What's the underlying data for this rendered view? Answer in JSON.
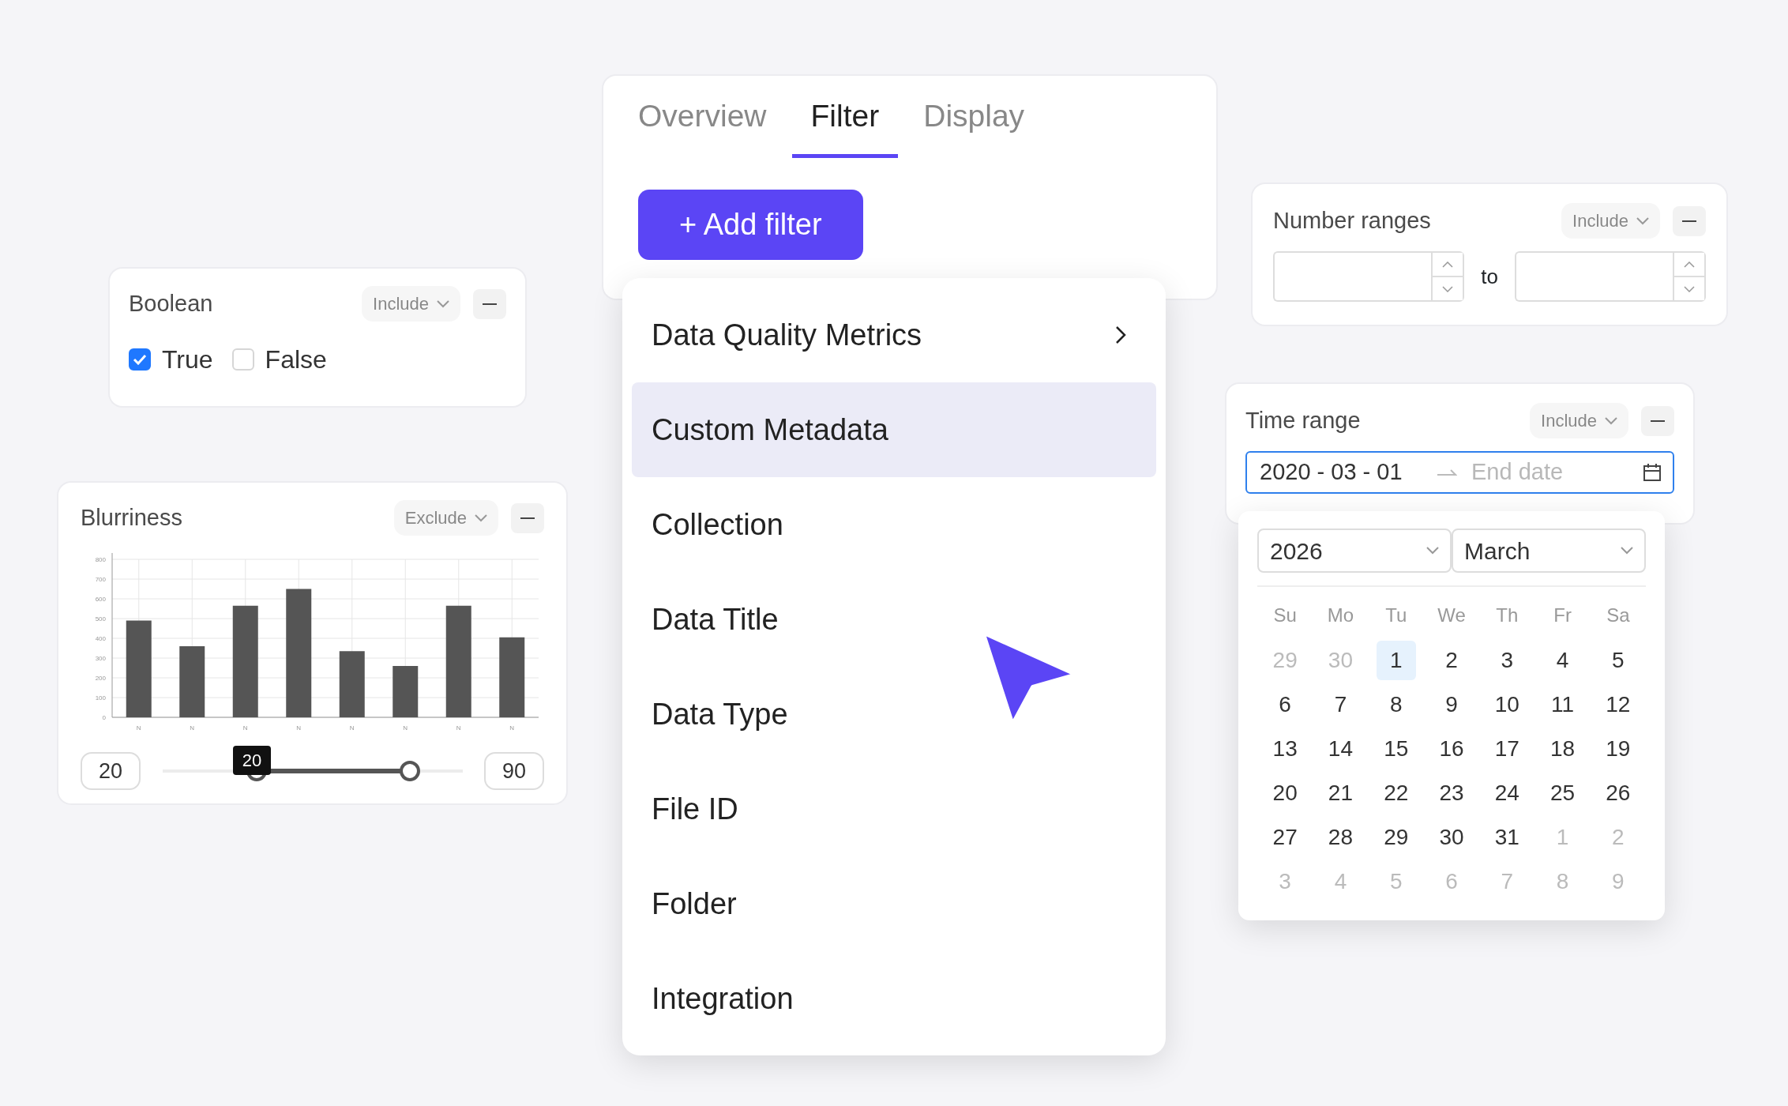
{
  "tabs_card": {
    "tabs": [
      {
        "label": "Overview",
        "selected": false
      },
      {
        "label": "Filter",
        "selected": true
      },
      {
        "label": "Display",
        "selected": false
      }
    ],
    "add_button": "+ Add filter"
  },
  "filter_menu": {
    "items": [
      {
        "label": "Data Quality Metrics",
        "selected": false,
        "has_submenu": true
      },
      {
        "label": "Custom Metadata",
        "selected": true,
        "has_submenu": false
      },
      {
        "label": "Collection",
        "selected": false,
        "has_submenu": false
      },
      {
        "label": "Data Title",
        "selected": false,
        "has_submenu": false
      },
      {
        "label": "Data Type",
        "selected": false,
        "has_submenu": false
      },
      {
        "label": "File ID",
        "selected": false,
        "has_submenu": false
      },
      {
        "label": "Folder",
        "selected": false,
        "has_submenu": false
      },
      {
        "label": "Integration",
        "selected": false,
        "has_submenu": false
      }
    ]
  },
  "boolean_card": {
    "title": "Boolean",
    "mode": "Include",
    "options": [
      {
        "label": "True",
        "checked": true
      },
      {
        "label": "False",
        "checked": false
      }
    ]
  },
  "blurriness_card": {
    "title": "Blurriness",
    "mode": "Exclude",
    "chart_data": {
      "type": "bar",
      "categories": [
        "N",
        "N",
        "N",
        "N",
        "N",
        "N",
        "N",
        "N"
      ],
      "grid": true,
      "series": [
        {
          "color": "#555555",
          "values": [
            490,
            360,
            565,
            650,
            335,
            260,
            565,
            405
          ]
        }
      ],
      "ylim": [
        0,
        800
      ],
      "yticks": [
        0,
        100,
        200,
        300,
        400,
        500,
        600,
        700,
        800
      ]
    },
    "min_value": "20",
    "max_value": "90",
    "tooltip": "20",
    "thumbs": [
      {
        "level": 0.3
      },
      {
        "level": 0.85
      }
    ]
  },
  "number_ranges_card": {
    "title": "Number ranges",
    "mode": "Include",
    "separator": "to"
  },
  "time_range_card": {
    "title": "Time range",
    "mode": "Include",
    "start_value": "2020 - 03 - 01",
    "end_placeholder": "End date",
    "focused": true
  },
  "calendar": {
    "year": "2026",
    "month": "March",
    "weekdays": [
      "Su",
      "Mo",
      "Tu",
      "We",
      "Th",
      "Fr",
      "Sa"
    ],
    "weeks": [
      [
        {
          "label": "29",
          "outside": true,
          "selected": false
        },
        {
          "label": "30",
          "outside": true,
          "selected": false
        },
        {
          "label": "1",
          "outside": false,
          "selected": true
        },
        {
          "label": "2",
          "outside": false,
          "selected": false
        },
        {
          "label": "3",
          "outside": false,
          "selected": false
        },
        {
          "label": "4",
          "outside": false,
          "selected": false
        },
        {
          "label": "5",
          "outside": false,
          "selected": false
        }
      ],
      [
        {
          "label": "6",
          "outside": false,
          "selected": false
        },
        {
          "label": "7",
          "outside": false,
          "selected": false
        },
        {
          "label": "8",
          "outside": false,
          "selected": false
        },
        {
          "label": "9",
          "outside": false,
          "selected": false
        },
        {
          "label": "10",
          "outside": false,
          "selected": false
        },
        {
          "label": "11",
          "outside": false,
          "selected": false
        },
        {
          "label": "12",
          "outside": false,
          "selected": false
        }
      ],
      [
        {
          "label": "13",
          "outside": false,
          "selected": false
        },
        {
          "label": "14",
          "outside": false,
          "selected": false
        },
        {
          "label": "15",
          "outside": false,
          "selected": false
        },
        {
          "label": "16",
          "outside": false,
          "selected": false
        },
        {
          "label": "17",
          "outside": false,
          "selected": false
        },
        {
          "label": "18",
          "outside": false,
          "selected": false
        },
        {
          "label": "19",
          "outside": false,
          "selected": false
        }
      ],
      [
        {
          "label": "20",
          "outside": false,
          "selected": false
        },
        {
          "label": "21",
          "outside": false,
          "selected": false
        },
        {
          "label": "22",
          "outside": false,
          "selected": false
        },
        {
          "label": "23",
          "outside": false,
          "selected": false
        },
        {
          "label": "24",
          "outside": false,
          "selected": false
        },
        {
          "label": "25",
          "outside": false,
          "selected": false
        },
        {
          "label": "26",
          "outside": false,
          "selected": false
        }
      ],
      [
        {
          "label": "27",
          "outside": false,
          "selected": false
        },
        {
          "label": "28",
          "outside": false,
          "selected": false
        },
        {
          "label": "29",
          "outside": false,
          "selected": false
        },
        {
          "label": "30",
          "outside": false,
          "selected": false
        },
        {
          "label": "31",
          "outside": false,
          "selected": false
        },
        {
          "label": "1",
          "outside": true,
          "selected": false
        },
        {
          "label": "2",
          "outside": true,
          "selected": false
        }
      ],
      [
        {
          "label": "3",
          "outside": true,
          "selected": false
        },
        {
          "label": "4",
          "outside": true,
          "selected": false
        },
        {
          "label": "5",
          "outside": true,
          "selected": false
        },
        {
          "label": "6",
          "outside": true,
          "selected": false
        },
        {
          "label": "7",
          "outside": true,
          "selected": false
        },
        {
          "label": "8",
          "outside": true,
          "selected": false
        },
        {
          "label": "9",
          "outside": true,
          "selected": false
        }
      ]
    ]
  }
}
